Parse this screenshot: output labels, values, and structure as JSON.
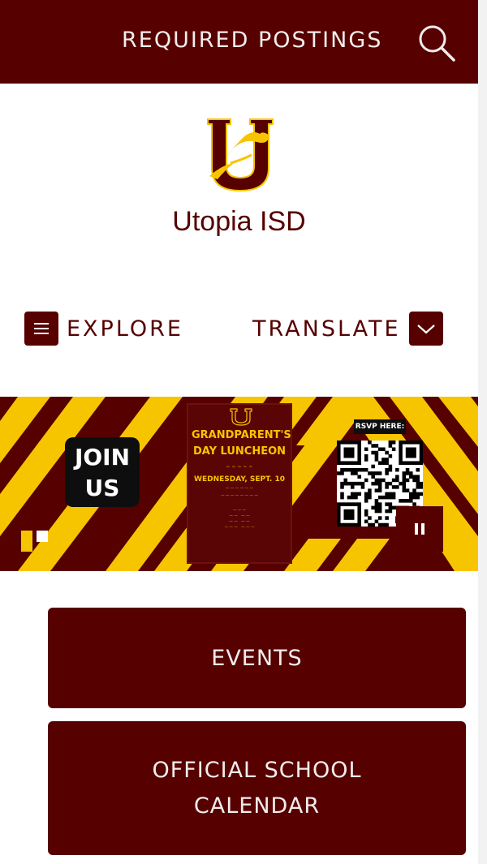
{
  "header": {
    "required_postings": "REQUIRED POSTINGS",
    "search_icon": "search-icon"
  },
  "site": {
    "logo_letter": "U",
    "name": "Utopia ISD"
  },
  "nav": {
    "explore": "EXPLORE",
    "translate": "TRANSLATE"
  },
  "banner": {
    "join_line1": "JOIN",
    "join_line2": "US",
    "poster_title": "GRANDPARENT'S DAY LUNCHEON",
    "poster_date": "WEDNESDAY, SEPT. 10",
    "rsvp": "RSVP HERE:",
    "pause_icon": "pause-icon",
    "slides_total": 2,
    "slide_current": 1
  },
  "buttons": {
    "events": "EVENTS",
    "calendar": "OFFICIAL SCHOOL CALENDAR"
  },
  "colors": {
    "maroon": "#560000",
    "gold": "#f7c500",
    "white": "#ffffff"
  }
}
